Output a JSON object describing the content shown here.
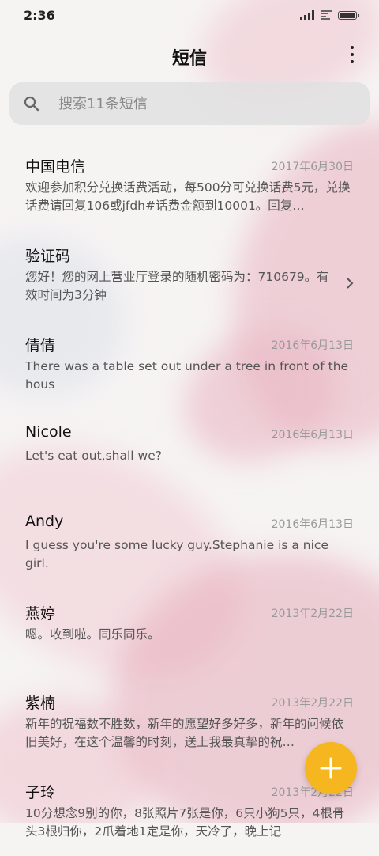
{
  "status": {
    "time": "2:36"
  },
  "header": {
    "title": "短信",
    "menu_icon": "more-vertical-icon"
  },
  "search": {
    "placeholder": "搜索11条短信",
    "icon": "search-icon"
  },
  "conversations": [
    {
      "name": "中国电信",
      "date": "2017年6月30日",
      "message": "欢迎参加积分兑换话费活动，每500分可兑换话费5元，兑换话费请回复106或jfdh#话费金额到10001。回复…"
    },
    {
      "name": "验证码",
      "date": "",
      "message": "您好！您的网上营业厅登录的随机密码为：710679。有效时间为3分钟"
    },
    {
      "name": "倩倩",
      "date": "2016年6月13日",
      "message": "There was a table set out under a tree in front of the hous"
    },
    {
      "name": "Nicole",
      "date": "2016年6月13日",
      "message": "Let's eat out,shall we?"
    },
    {
      "name": "Andy",
      "date": "2016年6月13日",
      "message": "I guess you're some lucky guy.Stephanie is a nice girl."
    },
    {
      "name": "燕婷",
      "date": "2013年2月22日",
      "message": "嗯。收到啦。同乐同乐。"
    },
    {
      "name": "紫楠",
      "date": "2013年2月22日",
      "message": "新年的祝福数不胜数，新年的愿望好多好多，新年的问候依旧美好，在这个温馨的时刻，送上我最真挚的祝…"
    },
    {
      "name": "子玲",
      "date": "2013年2月22日",
      "message": "10分想念9别的你，8张照片7张是你，6只小狗5只，4根骨头3根归你，2爪着地1定是你，天冷了，晚上记"
    }
  ],
  "fab": {
    "icon": "plus-icon",
    "color": "#f5b61f"
  }
}
